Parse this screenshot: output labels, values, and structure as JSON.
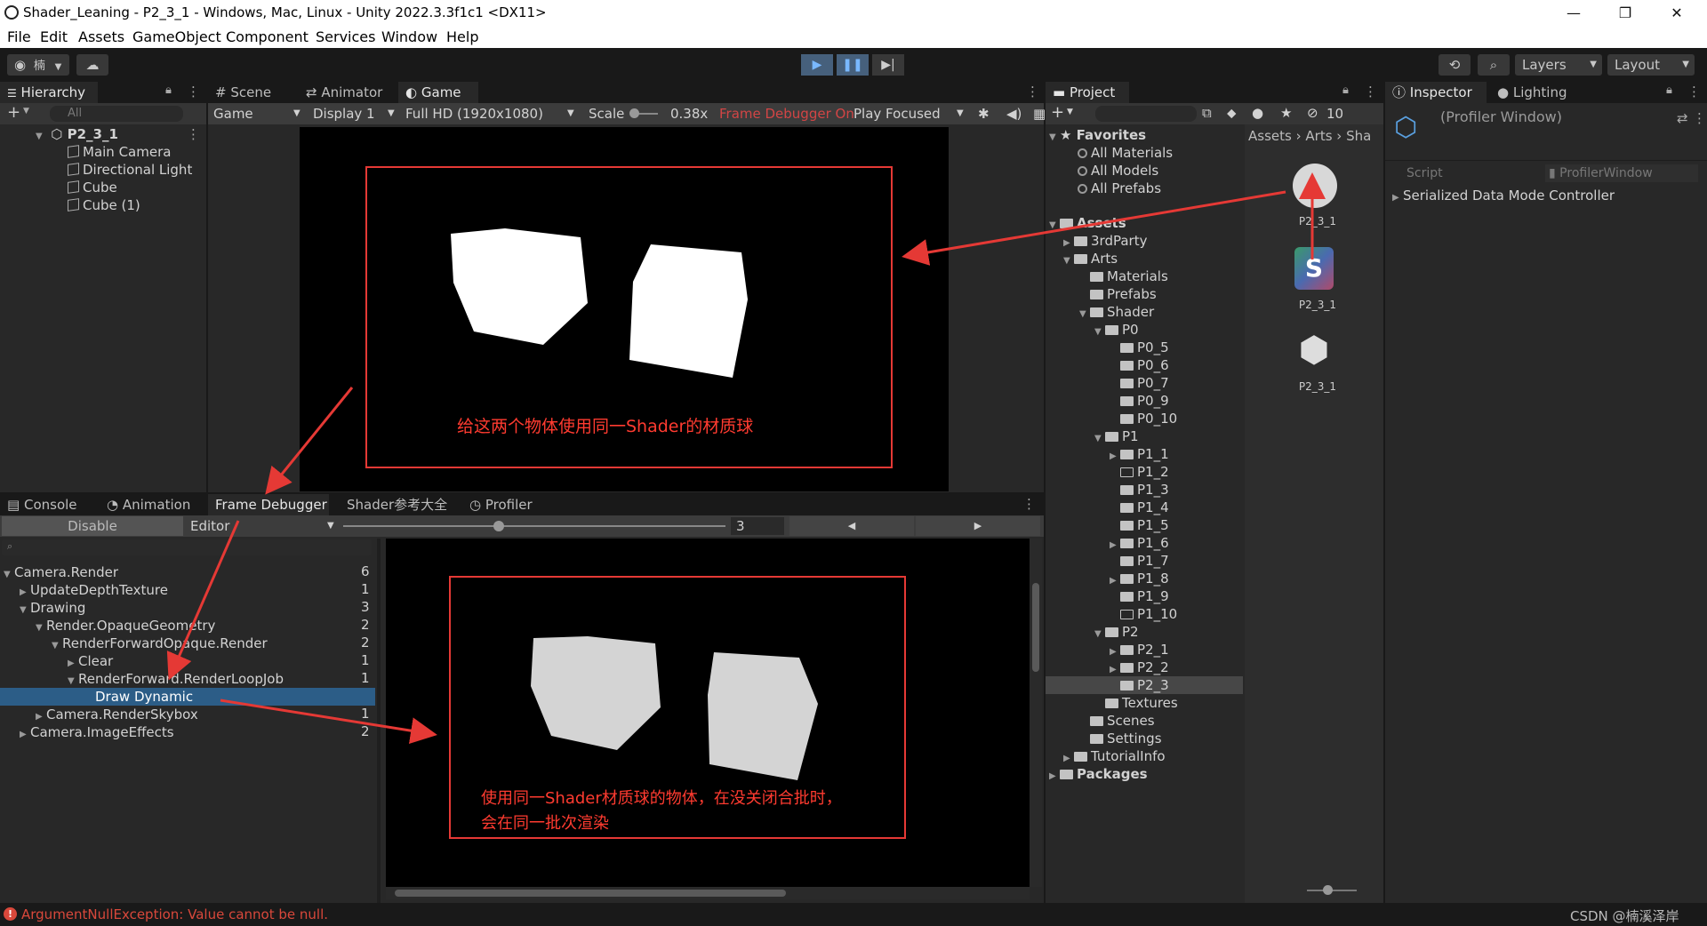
{
  "window": {
    "title": "Shader_Leaning - P2_3_1 - Windows, Mac, Linux - Unity 2022.3.3f1c1 <DX11>",
    "minimize": "—",
    "maximize": "❐",
    "close": "✕"
  },
  "menu": [
    "File",
    "Edit",
    "Assets",
    "GameObject",
    "Component",
    "Services",
    "Window",
    "Help"
  ],
  "toolbar": {
    "account_label": "楠",
    "layers_label": "Layers",
    "layout_label": "Layout"
  },
  "hierarchy": {
    "tab": "Hierarchy",
    "search_placeholder": "All",
    "scene": "P2_3_1",
    "items": [
      "Main Camera",
      "Directional Light",
      "Cube",
      "Cube (1)"
    ]
  },
  "scene_tabs": [
    "Scene",
    "Animator",
    "Game"
  ],
  "game_toolbar": {
    "view": "Game",
    "display": "Display 1",
    "resolution": "Full HD (1920x1080)",
    "scale_label": "Scale",
    "scale_value": "0.38x",
    "frame_debugger_status": "Frame Debugger On",
    "play_mode": "Play Focused"
  },
  "annotations": {
    "game_note": "给这两个物体使用同一Shader的材质球",
    "debugger_note_line1": "使用同一Shader材质球的物体，在没关闭合批时，",
    "debugger_note_line2": "会在同一批次渲染"
  },
  "bottom_tabs": [
    "Console",
    "Animation",
    "Frame Debugger",
    "Shader参考大全",
    "Profiler"
  ],
  "frame_debugger": {
    "disable_label": "Disable",
    "target": "Editor",
    "step": "3",
    "tree": [
      {
        "label": "Camera.Render",
        "count": "6"
      },
      {
        "label": "UpdateDepthTexture",
        "count": "1"
      },
      {
        "label": "Drawing",
        "count": "3"
      },
      {
        "label": "Render.OpaqueGeometry",
        "count": "2"
      },
      {
        "label": "RenderForwardOpaque.Render",
        "count": "2"
      },
      {
        "label": "Clear",
        "count": "1"
      },
      {
        "label": "RenderForward.RenderLoopJob",
        "count": "1"
      },
      {
        "label": "Draw Dynamic",
        "count": ""
      },
      {
        "label": "Camera.RenderSkybox",
        "count": "1"
      },
      {
        "label": "Camera.ImageEffects",
        "count": "2"
      }
    ]
  },
  "project": {
    "tab": "Project",
    "hidden_count": "10",
    "favorites_label": "Favorites",
    "favorites": [
      "All Materials",
      "All Models",
      "All Prefabs"
    ],
    "breadcrumb": [
      "Assets",
      "Arts",
      "Sha"
    ],
    "tree": [
      "Assets",
      "3rdParty",
      "Arts",
      "Materials",
      "Prefabs",
      "Shader",
      "P0",
      "P0_5",
      "P0_6",
      "P0_7",
      "P0_9",
      "P0_10",
      "P1",
      "P1_1",
      "P1_2",
      "P1_3",
      "P1_4",
      "P1_5",
      "P1_6",
      "P1_7",
      "P1_8",
      "P1_9",
      "P1_10",
      "P2",
      "P2_1",
      "P2_2",
      "P2_3",
      "Textures",
      "Scenes",
      "Settings",
      "TutorialInfo",
      "Packages"
    ],
    "assets": [
      "P2_3_1",
      "P2_3_1",
      "P2_3_1"
    ]
  },
  "inspector": {
    "tab": "Inspector",
    "lighting_tab": "Lighting",
    "title": "(Profiler Window)",
    "script_label": "Script",
    "script_value": "ProfilerWindow",
    "row": "Serialized Data Mode Controller"
  },
  "status": {
    "error": "ArgumentNullException: Value cannot be null.",
    "watermark": "CSDN @楠溪泽岸"
  },
  "colors": {
    "annotation_red": "#e53935",
    "selection_blue": "#2c5d87",
    "play_active": "#46607c"
  }
}
